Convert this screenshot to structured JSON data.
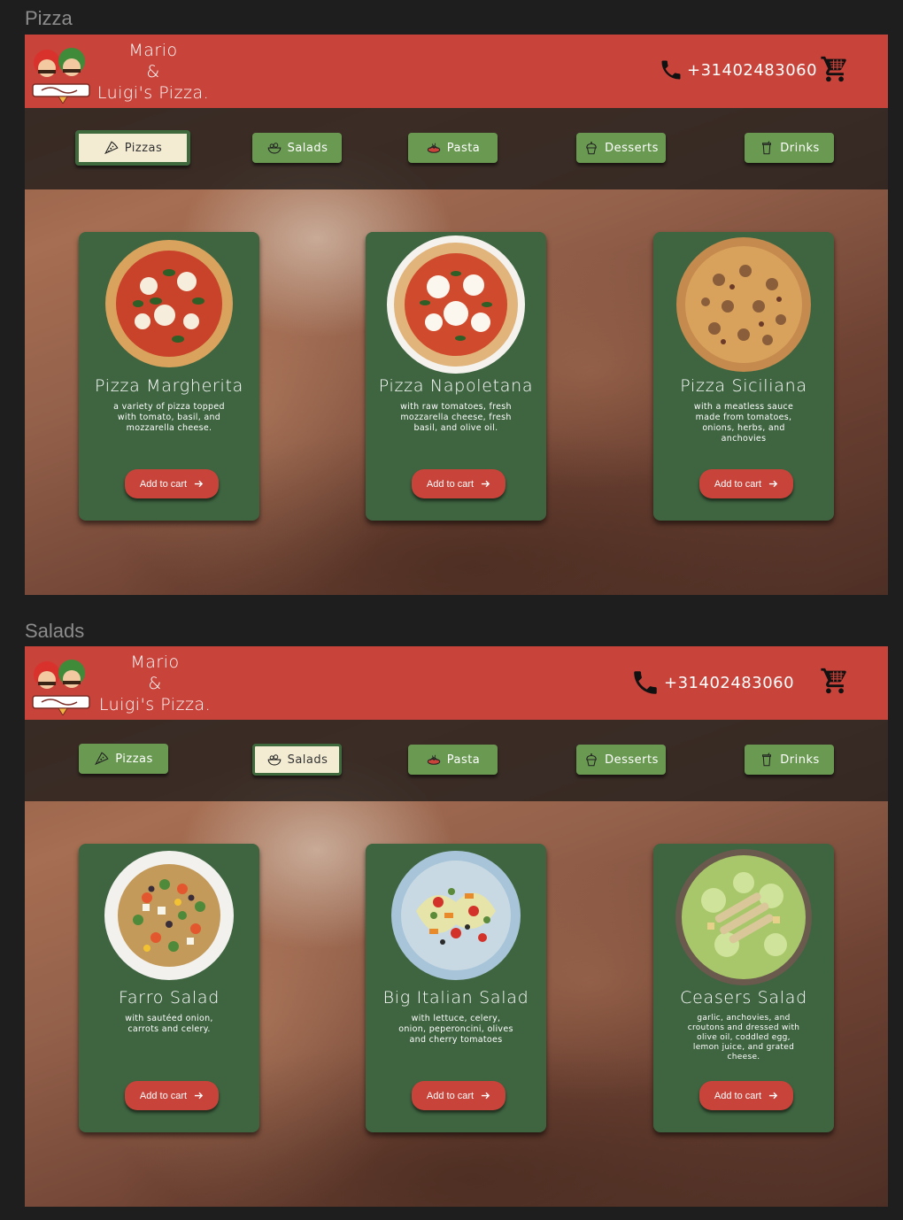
{
  "frames": [
    {
      "label": "Pizza",
      "brand_lines": [
        "Mario",
        "&",
        "Luigi's Pizza."
      ],
      "phone": "+31402483060",
      "nav": [
        {
          "label": "Pizzas",
          "icon": "pizza-slice-icon",
          "active": true
        },
        {
          "label": "Salads",
          "icon": "salad-bowl-icon",
          "active": false
        },
        {
          "label": "Pasta",
          "icon": "pasta-plate-icon",
          "active": false
        },
        {
          "label": "Desserts",
          "icon": "cupcake-icon",
          "active": false
        },
        {
          "label": "Drinks",
          "icon": "drink-cup-icon",
          "active": false
        }
      ],
      "cards": [
        {
          "title": "Pizza Margherita",
          "desc": "a variety of pizza topped with tomato, basil, and mozzarella cheese.",
          "button": "Add to cart",
          "image": "pizza-margherita-image"
        },
        {
          "title": "Pizza Napoletana",
          "desc": "with raw tomatoes, fresh mozzarella cheese, fresh basil, and olive oil.",
          "button": "Add to cart",
          "image": "pizza-napoletana-image"
        },
        {
          "title": "Pizza Siciliana",
          "desc": "with a meatless sauce made from tomatoes, onions, herbs, and anchovies",
          "button": "Add to cart",
          "image": "pizza-siciliana-image"
        }
      ]
    },
    {
      "label": "Salads",
      "brand_lines": [
        "Mario",
        "&",
        "Luigi's Pizza."
      ],
      "phone": "+31402483060",
      "nav": [
        {
          "label": "Pizzas",
          "icon": "pizza-slice-icon",
          "active": false
        },
        {
          "label": "Salads",
          "icon": "salad-bowl-icon",
          "active": true
        },
        {
          "label": "Pasta",
          "icon": "pasta-plate-icon",
          "active": false
        },
        {
          "label": "Desserts",
          "icon": "cupcake-icon",
          "active": false
        },
        {
          "label": "Drinks",
          "icon": "drink-cup-icon",
          "active": false
        }
      ],
      "cards": [
        {
          "title": "Farro Salad",
          "desc": "with sautéed onion, carrots and celery.",
          "button": "Add to cart",
          "image": "farro-salad-image"
        },
        {
          "title": "Big Italian Salad",
          "desc": "with lettuce, celery, onion, peperoncini, olives and cherry tomatoes",
          "button": "Add to cart",
          "image": "big-italian-salad-image"
        },
        {
          "title": "Ceasers Salad",
          "desc": "garlic, anchovies, and croutons and dressed with olive oil, coddled egg, lemon juice, and grated cheese.",
          "button": "Add to cart",
          "image": "ceasers-salad-image"
        }
      ]
    }
  ],
  "colors": {
    "header_red": "#c8433a",
    "card_green": "#3e6440",
    "nav_green": "#6a9a52",
    "nav_active_bg": "#f3ecd3",
    "canvas_bg": "#1e1e1e"
  }
}
